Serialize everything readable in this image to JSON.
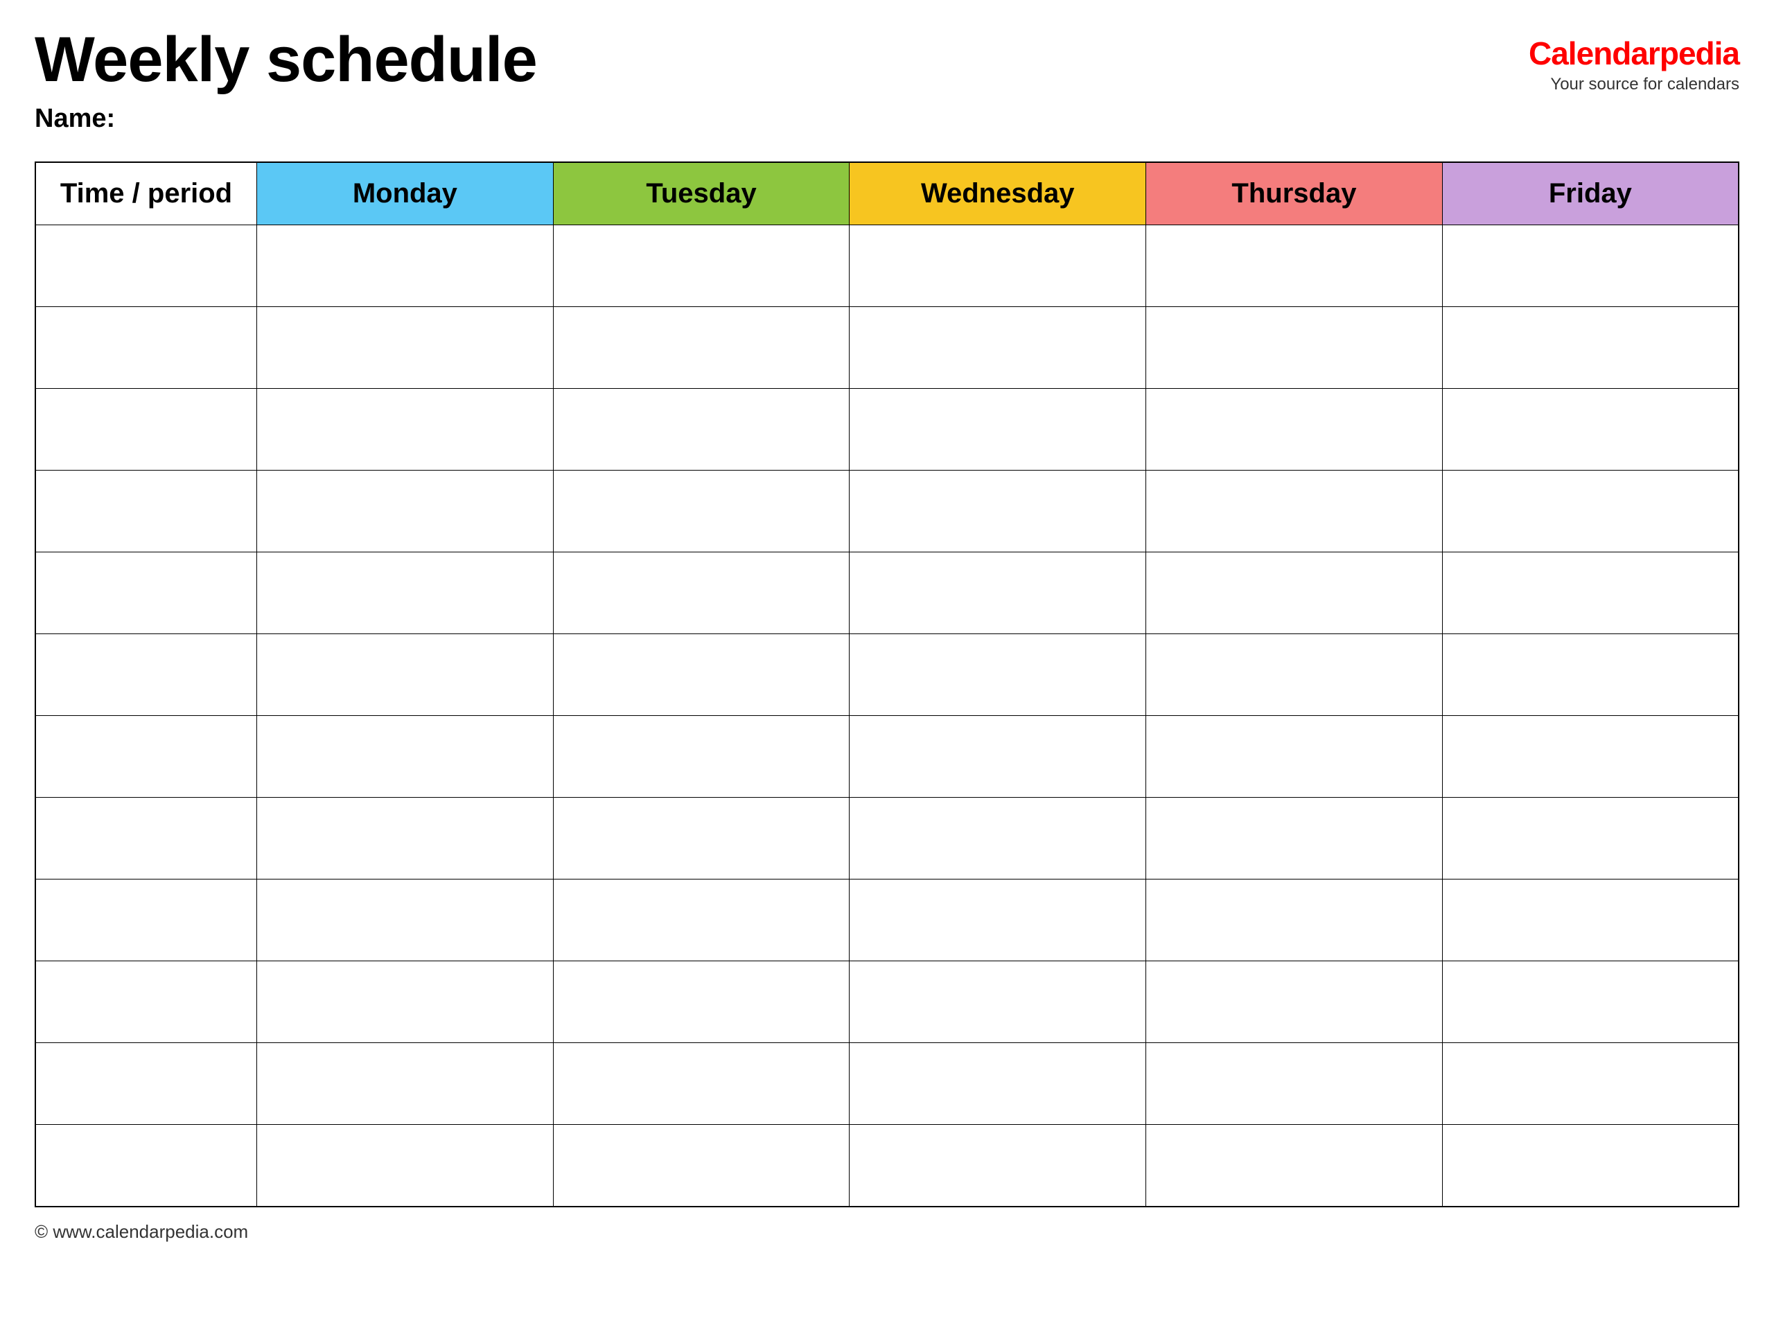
{
  "header": {
    "title": "Weekly schedule",
    "name_label": "Name:",
    "logo_text_main": "Calendar",
    "logo_text_accent": "pedia",
    "logo_tagline": "Your source for calendars"
  },
  "table": {
    "columns": [
      {
        "key": "time",
        "label": "Time / period",
        "color": "#ffffff"
      },
      {
        "key": "monday",
        "label": "Monday",
        "color": "#5bc8f5"
      },
      {
        "key": "tuesday",
        "label": "Tuesday",
        "color": "#8dc63f"
      },
      {
        "key": "wednesday",
        "label": "Wednesday",
        "color": "#f7c520"
      },
      {
        "key": "thursday",
        "label": "Thursday",
        "color": "#f47d7d"
      },
      {
        "key": "friday",
        "label": "Friday",
        "color": "#c9a0dc"
      }
    ],
    "row_count": 12
  },
  "footer": {
    "url": "© www.calendarpedia.com"
  }
}
